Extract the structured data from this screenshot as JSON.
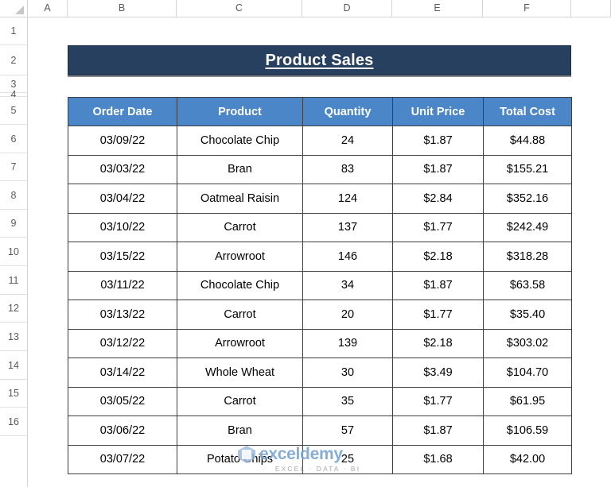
{
  "spreadsheet": {
    "column_headers": [
      "A",
      "B",
      "C",
      "D",
      "E",
      "F"
    ],
    "row_numbers": [
      "1",
      "2",
      "3",
      "4",
      "5",
      "6",
      "7",
      "8",
      "9",
      "10",
      "11",
      "12",
      "13",
      "14",
      "15",
      "16"
    ],
    "corner_icon": "select-all-triangle-icon"
  },
  "title": {
    "text": "Product Sales",
    "fill_color": "#27405F",
    "text_color": "#FFFFFF"
  },
  "table": {
    "header_fill": "#4A86C8",
    "header_text_color": "#FFFFFF",
    "border_color": "#3F3F3F",
    "columns": [
      "Order Date",
      "Product",
      "Quantity",
      "Unit Price",
      "Total Cost"
    ],
    "rows": [
      {
        "order_date": "03/09/22",
        "product": "Chocolate Chip",
        "quantity": "24",
        "unit_price": "$1.87",
        "total_cost": "$44.88"
      },
      {
        "order_date": "03/03/22",
        "product": "Bran",
        "quantity": "83",
        "unit_price": "$1.87",
        "total_cost": "$155.21"
      },
      {
        "order_date": "03/04/22",
        "product": "Oatmeal Raisin",
        "quantity": "124",
        "unit_price": "$2.84",
        "total_cost": "$352.16"
      },
      {
        "order_date": "03/10/22",
        "product": "Carrot",
        "quantity": "137",
        "unit_price": "$1.77",
        "total_cost": "$242.49"
      },
      {
        "order_date": "03/15/22",
        "product": "Arrowroot",
        "quantity": "146",
        "unit_price": "$2.18",
        "total_cost": "$318.28"
      },
      {
        "order_date": "03/11/22",
        "product": "Chocolate Chip",
        "quantity": "34",
        "unit_price": "$1.87",
        "total_cost": "$63.58"
      },
      {
        "order_date": "03/13/22",
        "product": "Carrot",
        "quantity": "20",
        "unit_price": "$1.77",
        "total_cost": "$35.40"
      },
      {
        "order_date": "03/12/22",
        "product": "Arrowroot",
        "quantity": "139",
        "unit_price": "$2.18",
        "total_cost": "$303.02"
      },
      {
        "order_date": "03/14/22",
        "product": "Whole Wheat",
        "quantity": "30",
        "unit_price": "$3.49",
        "total_cost": "$104.70"
      },
      {
        "order_date": "03/05/22",
        "product": "Carrot",
        "quantity": "35",
        "unit_price": "$1.77",
        "total_cost": "$61.95"
      },
      {
        "order_date": "03/06/22",
        "product": "Bran",
        "quantity": "57",
        "unit_price": "$1.87",
        "total_cost": "$106.59"
      },
      {
        "order_date": "03/07/22",
        "product": "Potato Chips",
        "quantity": "25",
        "unit_price": "$1.68",
        "total_cost": "$42.00"
      }
    ]
  },
  "watermark": {
    "name": "exceldemy",
    "tagline": "EXCEL · DATA · BI",
    "logo_icon": "exceldemy-hexagon-logo-icon"
  }
}
